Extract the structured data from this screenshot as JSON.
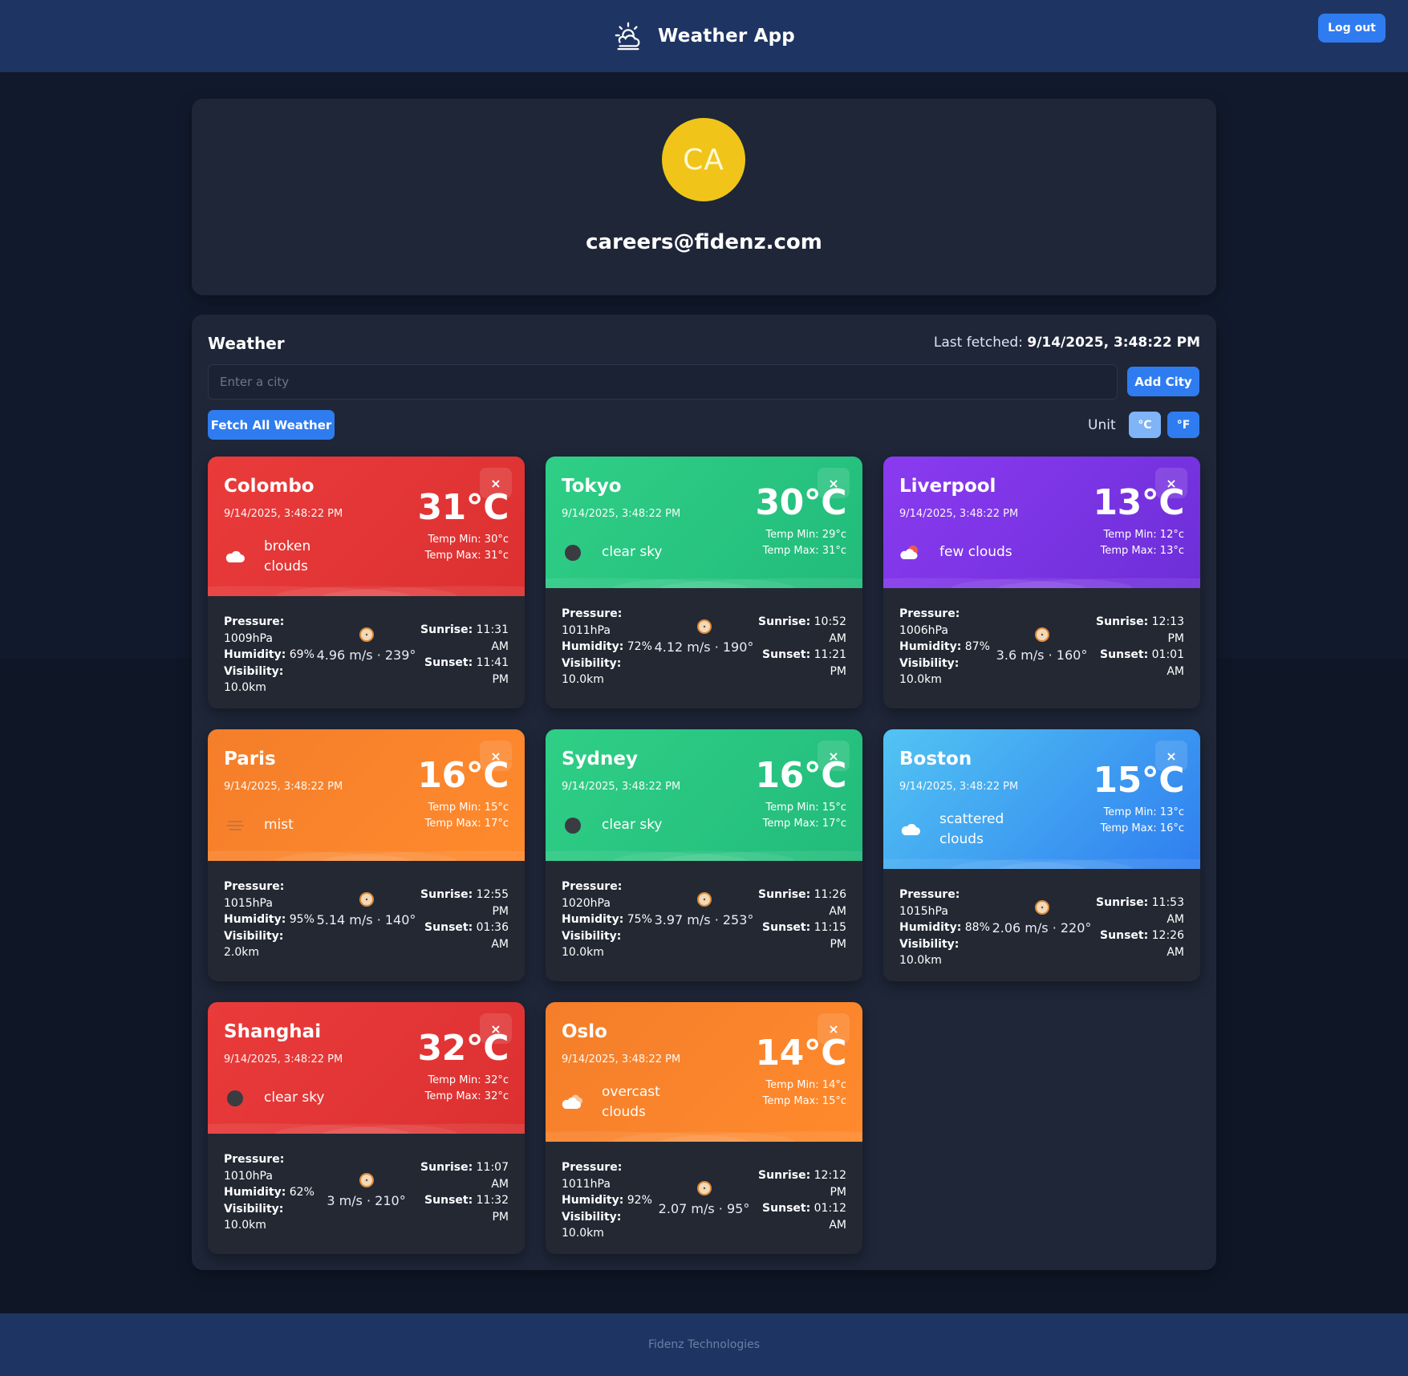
{
  "header": {
    "title": "Weather App",
    "logout_label": "Log out"
  },
  "profile": {
    "initials": "CA",
    "email": "careers@fidenz.com"
  },
  "weather": {
    "title": "Weather",
    "last_fetched_label": "Last fetched:",
    "last_fetched_value": "9/14/2025, 3:48:22 PM",
    "city_placeholder": "Enter a city",
    "add_city_label": "Add City",
    "fetch_all_label": "Fetch All Weather",
    "unit_label": "Unit",
    "unit_c": "°C",
    "unit_f": "°F",
    "selected_unit": "°C"
  },
  "labels": {
    "pressure": "Pressure:",
    "humidity": "Humidity:",
    "visibility": "Visibility:",
    "sunrise": "Sunrise:",
    "sunset": "Sunset:",
    "close": "×"
  },
  "cards": [
    {
      "city": "Colombo",
      "timestamp": "9/14/2025, 3:48:22 PM",
      "temp": "31°C",
      "temp_min": "Temp Min: 30°c",
      "temp_max": "Temp Max: 31°c",
      "condition": "broken clouds",
      "icon": "broken-clouds-icon",
      "color": "red",
      "pressure": "1009hPa",
      "humidity": "69%",
      "visibility": "10.0km",
      "wind": "4.96 m/s · 239°",
      "sunrise": "11:31 AM",
      "sunset": "11:41 PM"
    },
    {
      "city": "Tokyo",
      "timestamp": "9/14/2025, 3:48:22 PM",
      "temp": "30°C",
      "temp_min": "Temp Min: 29°c",
      "temp_max": "Temp Max: 31°c",
      "condition": "clear sky",
      "icon": "clear-sky-icon",
      "color": "green",
      "pressure": "1011hPa",
      "humidity": "72%",
      "visibility": "10.0km",
      "wind": "4.12 m/s · 190°",
      "sunrise": "10:52 AM",
      "sunset": "11:21 PM"
    },
    {
      "city": "Liverpool",
      "timestamp": "9/14/2025, 3:48:22 PM",
      "temp": "13°C",
      "temp_min": "Temp Min: 12°c",
      "temp_max": "Temp Max: 13°c",
      "condition": "few clouds",
      "icon": "few-clouds-icon",
      "color": "purple",
      "pressure": "1006hPa",
      "humidity": "87%",
      "visibility": "10.0km",
      "wind": "3.6 m/s · 160°",
      "sunrise": "12:13 PM",
      "sunset": "01:01 AM"
    },
    {
      "city": "Paris",
      "timestamp": "9/14/2025, 3:48:22 PM",
      "temp": "16°C",
      "temp_min": "Temp Min: 15°c",
      "temp_max": "Temp Max: 17°c",
      "condition": "mist",
      "icon": "mist-icon",
      "color": "orange",
      "pressure": "1015hPa",
      "humidity": "95%",
      "visibility": "2.0km",
      "wind": "5.14 m/s · 140°",
      "sunrise": "12:55 PM",
      "sunset": "01:36 AM"
    },
    {
      "city": "Sydney",
      "timestamp": "9/14/2025, 3:48:22 PM",
      "temp": "16°C",
      "temp_min": "Temp Min: 15°c",
      "temp_max": "Temp Max: 17°c",
      "condition": "clear sky",
      "icon": "clear-sky-icon",
      "color": "green",
      "pressure": "1020hPa",
      "humidity": "75%",
      "visibility": "10.0km",
      "wind": "3.97 m/s · 253°",
      "sunrise": "11:26 AM",
      "sunset": "11:15 PM"
    },
    {
      "city": "Boston",
      "timestamp": "9/14/2025, 3:48:22 PM",
      "temp": "15°C",
      "temp_min": "Temp Min: 13°c",
      "temp_max": "Temp Max: 16°c",
      "condition": "scattered clouds",
      "icon": "scattered-clouds-icon",
      "color": "blue",
      "pressure": "1015hPa",
      "humidity": "88%",
      "visibility": "10.0km",
      "wind": "2.06 m/s · 220°",
      "sunrise": "11:53 AM",
      "sunset": "12:26 AM"
    },
    {
      "city": "Shanghai",
      "timestamp": "9/14/2025, 3:48:22 PM",
      "temp": "32°C",
      "temp_min": "Temp Min: 32°c",
      "temp_max": "Temp Max: 32°c",
      "condition": "clear sky",
      "icon": "clear-sky-icon",
      "color": "red",
      "pressure": "1010hPa",
      "humidity": "62%",
      "visibility": "10.0km",
      "wind": "3 m/s · 210°",
      "sunrise": "11:07 AM",
      "sunset": "11:32 PM"
    },
    {
      "city": "Oslo",
      "timestamp": "9/14/2025, 3:48:22 PM",
      "temp": "14°C",
      "temp_min": "Temp Min: 14°c",
      "temp_max": "Temp Max: 15°c",
      "condition": "overcast clouds",
      "icon": "overcast-clouds-icon",
      "color": "orange",
      "pressure": "1011hPa",
      "humidity": "92%",
      "visibility": "10.0km",
      "wind": "2.07 m/s · 95°",
      "sunrise": "12:12 PM",
      "sunset": "01:12 AM"
    }
  ],
  "footer": {
    "text": "Fidenz Technologies"
  }
}
